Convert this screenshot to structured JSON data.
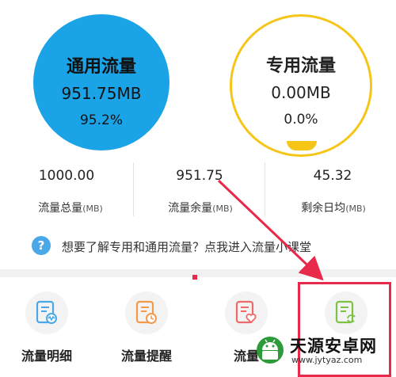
{
  "general": {
    "title": "通用流量",
    "amount": "951.75MB",
    "percent": "95.2%",
    "usage_fraction": 0.952,
    "color": "#1aa3e6"
  },
  "special": {
    "title": "专用流量",
    "amount": "0.00MB",
    "percent": "0.0%",
    "usage_fraction": 0.0,
    "color": "#f5c518"
  },
  "stats": [
    {
      "value": "1000.00",
      "label": "流量总量",
      "unit": "(MB)"
    },
    {
      "value": "951.75",
      "label": "流量余量",
      "unit": "(MB)"
    },
    {
      "value": "45.32",
      "label": "剩余日均",
      "unit": "(MB)"
    }
  ],
  "info": {
    "icon": "question-icon",
    "icon_glyph": "?",
    "text": "想要了解专用和通用流量？点我进入流量小课堂"
  },
  "tiles": [
    {
      "label": "流量明细",
      "icon": "usage-detail-icon",
      "color": "#4aa8e8"
    },
    {
      "label": "流量提醒",
      "icon": "usage-reminder-icon",
      "color": "#f39a4a"
    },
    {
      "label": "流量",
      "icon": "favorite-document-icon",
      "color": "#ee6a6a"
    },
    {
      "label": "",
      "icon": "refresh-document-icon",
      "color": "#7cc243"
    }
  ],
  "annotation": {
    "color": "#e8294a"
  },
  "watermark": {
    "name": "天源安卓网",
    "url": "www.jytyaz.com"
  }
}
